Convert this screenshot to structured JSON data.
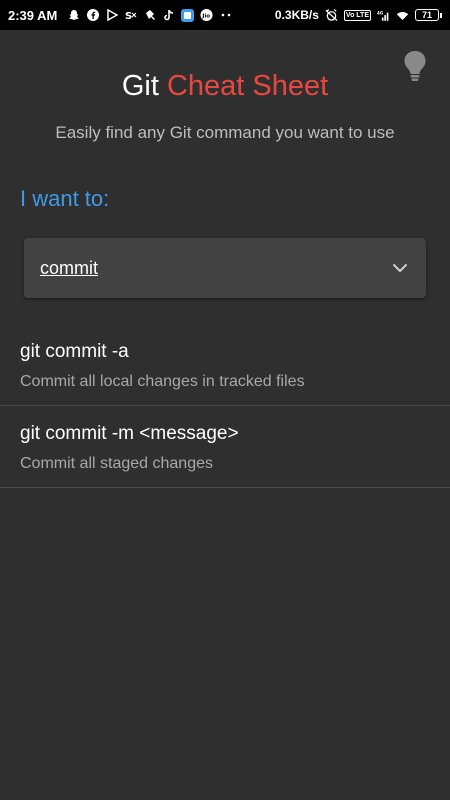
{
  "status_bar": {
    "time": "2:39 AM",
    "net_speed": "0.3KB/s",
    "volte": "Vo LTE",
    "network_type": "4G",
    "battery": "71",
    "left_icons": [
      "snapchat-icon",
      "facebook-icon",
      "play-store-icon",
      "app-icon",
      "tiktok-like-icon",
      "tiktok-icon",
      "app-square-icon",
      "jio-icon",
      "more-dots-icon"
    ]
  },
  "header": {
    "title_part1": "Git",
    "title_part2": "Cheat Sheet",
    "subtitle": "Easily find any Git command you want to use",
    "accent_color": "#e8483f",
    "label_color": "#3d9be9"
  },
  "selector": {
    "label": "I want to:",
    "value": "commit"
  },
  "commands": [
    {
      "name": "git commit -a",
      "description": "Commit all local changes in tracked files"
    },
    {
      "name": "git commit -m <message>",
      "description": "Commit all staged changes"
    }
  ]
}
